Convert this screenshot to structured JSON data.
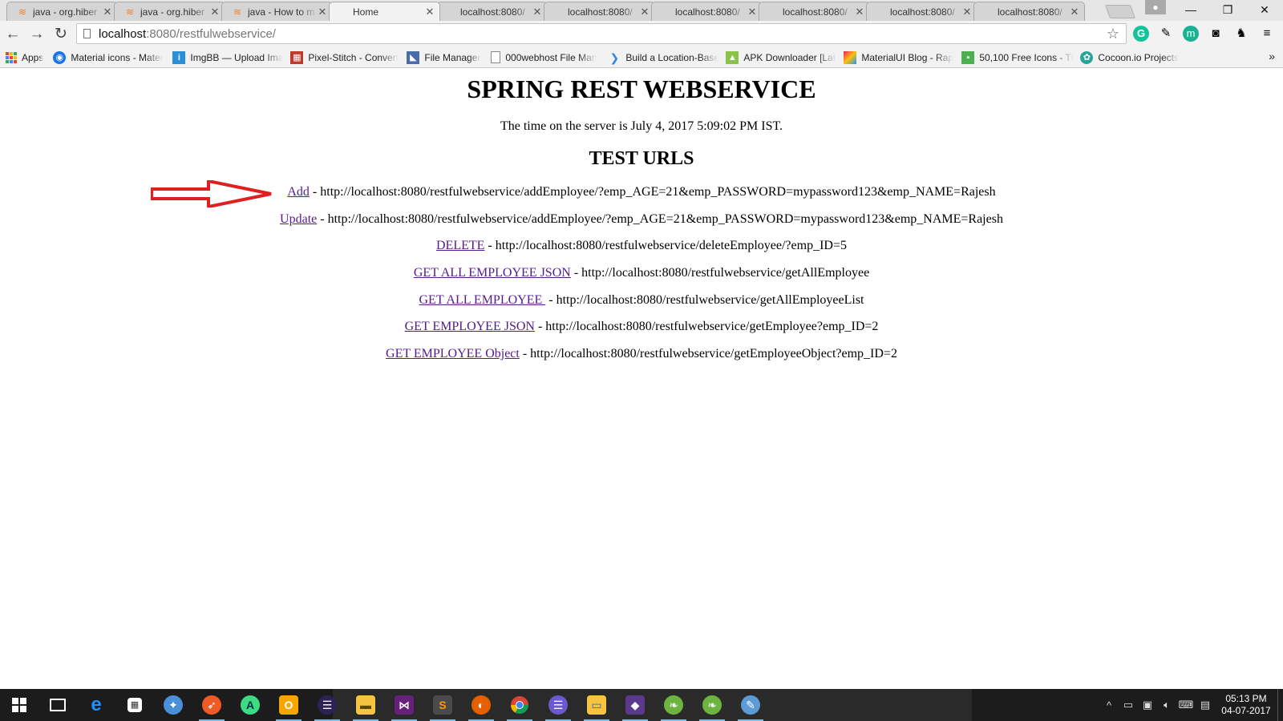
{
  "browser": {
    "tabs": [
      {
        "title": "java - org.hiber",
        "favicon": "stackoverflow-icon"
      },
      {
        "title": "java - org.hiber",
        "favicon": "stackoverflow-icon"
      },
      {
        "title": "java - How to m",
        "favicon": "stackoverflow-icon"
      },
      {
        "title": "Home",
        "favicon": "page-icon",
        "active": true
      },
      {
        "title": "localhost:8080/",
        "favicon": "page-icon"
      },
      {
        "title": "localhost:8080/",
        "favicon": "page-icon"
      },
      {
        "title": "localhost:8080/",
        "favicon": "page-icon"
      },
      {
        "title": "localhost:8080/",
        "favicon": "page-icon"
      },
      {
        "title": "localhost:8080/",
        "favicon": "page-icon"
      },
      {
        "title": "localhost:8080/",
        "favicon": "page-icon"
      }
    ],
    "address": {
      "host": "localhost",
      "path": ":8080/restfulwebservice/"
    },
    "bookmarks": [
      {
        "label": "Apps",
        "icon": "apps-grid-icon"
      },
      {
        "label": "Material icons - Mater",
        "icon": "material-icon",
        "color": "#1a73e8"
      },
      {
        "label": "ImgBB — Upload Ima",
        "icon": "imgbb-icon",
        "color": "#2a8fd8"
      },
      {
        "label": "Pixel-Stitch - Convert",
        "icon": "pixel-stitch-icon",
        "color": "#c0392b"
      },
      {
        "label": "File Manager",
        "icon": "file-manager-icon",
        "color": "#4a6da7"
      },
      {
        "label": "000webhost File Man",
        "icon": "page-icon",
        "color": "#888888"
      },
      {
        "label": "Build a Location-Base",
        "icon": "location-icon",
        "color": "#2e86de"
      },
      {
        "label": "APK Downloader [Late",
        "icon": "android-icon",
        "color": "#8bc34a"
      },
      {
        "label": "MaterialUI Blog - Rap",
        "icon": "materialui-icon",
        "color": "#e91e63"
      },
      {
        "label": "50,100 Free Icons - Th",
        "icon": "free-icons-icon",
        "color": "#4caf50"
      },
      {
        "label": "Cocoon.io Projects",
        "icon": "cocoon-icon",
        "color": "#26a69a"
      }
    ],
    "overflow_label": "»"
  },
  "page": {
    "heading": "SPRING REST WEBSERVICE",
    "server_time": "The time on the server is July 4, 2017 5:09:02 PM IST.",
    "subheading": "TEST URLS",
    "links": [
      {
        "label": "Add",
        "url": " - http://localhost:8080/restfulwebservice/addEmployee/?emp_AGE=21&emp_PASSWORD=mypassword123&emp_NAME=Rajesh"
      },
      {
        "label": "Update",
        "url": " - http://localhost:8080/restfulwebservice/addEmployee/?emp_AGE=21&emp_PASSWORD=mypassword123&emp_NAME=Rajesh"
      },
      {
        "label": "DELETE",
        "url": " - http://localhost:8080/restfulwebservice/deleteEmployee/?emp_ID=5"
      },
      {
        "label": "GET ALL EMPLOYEE JSON",
        "url": " - http://localhost:8080/restfulwebservice/getAllEmployee"
      },
      {
        "label": "GET ALL EMPLOYEE ",
        "url": " - http://localhost:8080/restfulwebservice/getAllEmployeeList"
      },
      {
        "label": "GET EMPLOYEE JSON",
        "url": " - http://localhost:8080/restfulwebservice/getEmployee?emp_ID=2"
      },
      {
        "label": "GET EMPLOYEE Object",
        "url": " - http://localhost:8080/restfulwebservice/getEmployeeObject?emp_ID=2"
      }
    ],
    "annotation_arrow_color": "#e02020"
  },
  "taskbar": {
    "clock_time": "05:13 PM",
    "clock_date": "04-07-2017"
  },
  "colors": {
    "link_visited": "#551a8b",
    "taskbar_bg": "#1c1c1c",
    "chrome_bg": "#f2f2f2"
  }
}
